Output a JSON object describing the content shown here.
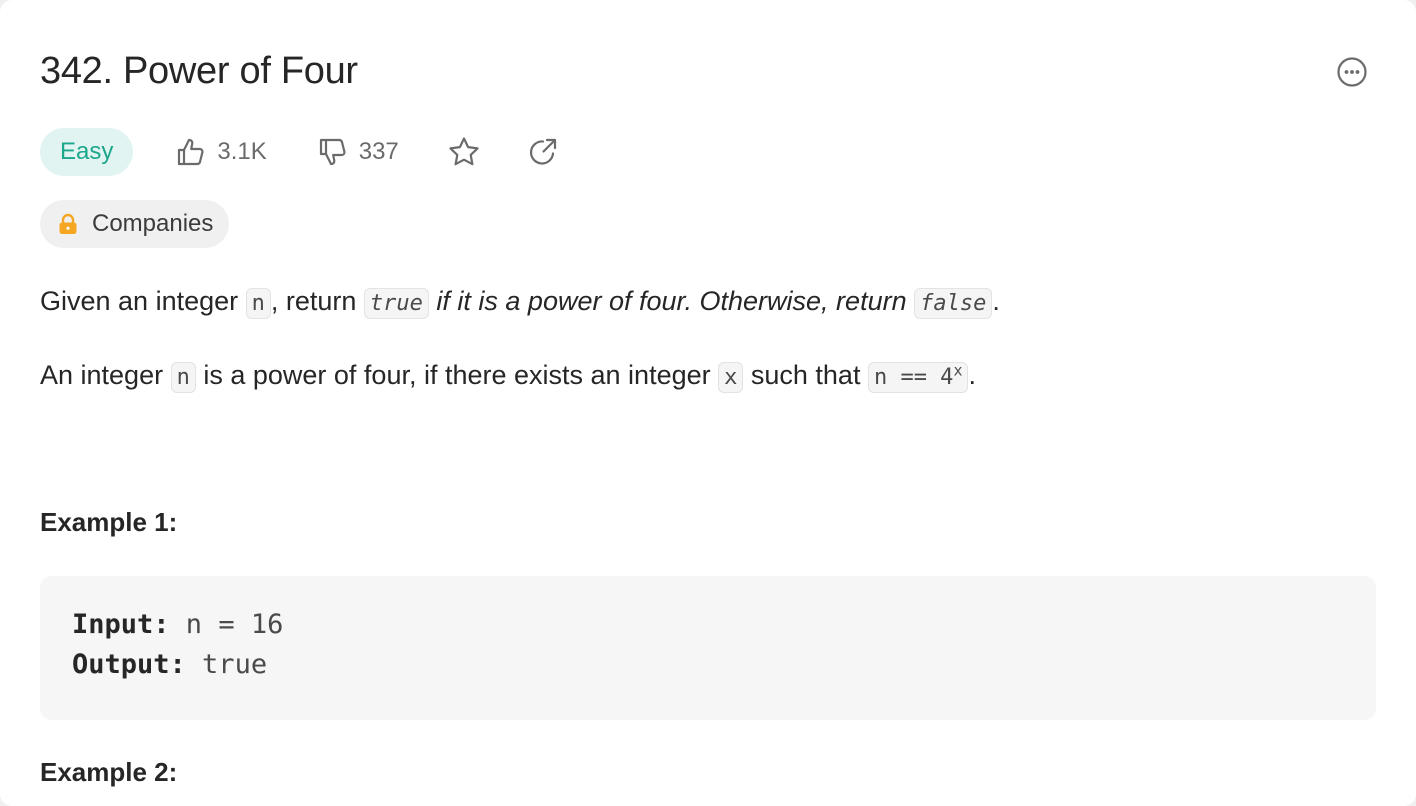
{
  "problem": {
    "title": "342. Power of Four",
    "difficulty": "Easy",
    "likes": "3.1K",
    "dislikes": "337",
    "companies_label": "Companies"
  },
  "description": {
    "p1": {
      "t1": "Given an integer ",
      "c1": "n",
      "t2": ", return ",
      "c2": "true",
      "t3": " if it is a power of four. Otherwise, return ",
      "c3": "false",
      "t4": "."
    },
    "p2": {
      "t1": "An integer ",
      "c1": "n",
      "t2": " is a power of four, if there exists an integer ",
      "c2": "x",
      "t3": " such that ",
      "c3_base": "n == 4",
      "c3_sup": "x",
      "t4": "."
    }
  },
  "examples": [
    {
      "title": "Example 1:",
      "input_label": "Input:",
      "input_value": " n = 16",
      "output_label": "Output:",
      "output_value": " true"
    },
    {
      "title": "Example 2:"
    }
  ],
  "colors": {
    "easy_text": "#1ca68b",
    "easy_bg": "#e1f4f1",
    "lock": "#f5a623"
  },
  "icons": {
    "more": "more-icon",
    "like": "thumbs-up-icon",
    "dislike": "thumbs-down-icon",
    "star": "star-icon",
    "share": "share-icon",
    "lock": "lock-icon"
  }
}
